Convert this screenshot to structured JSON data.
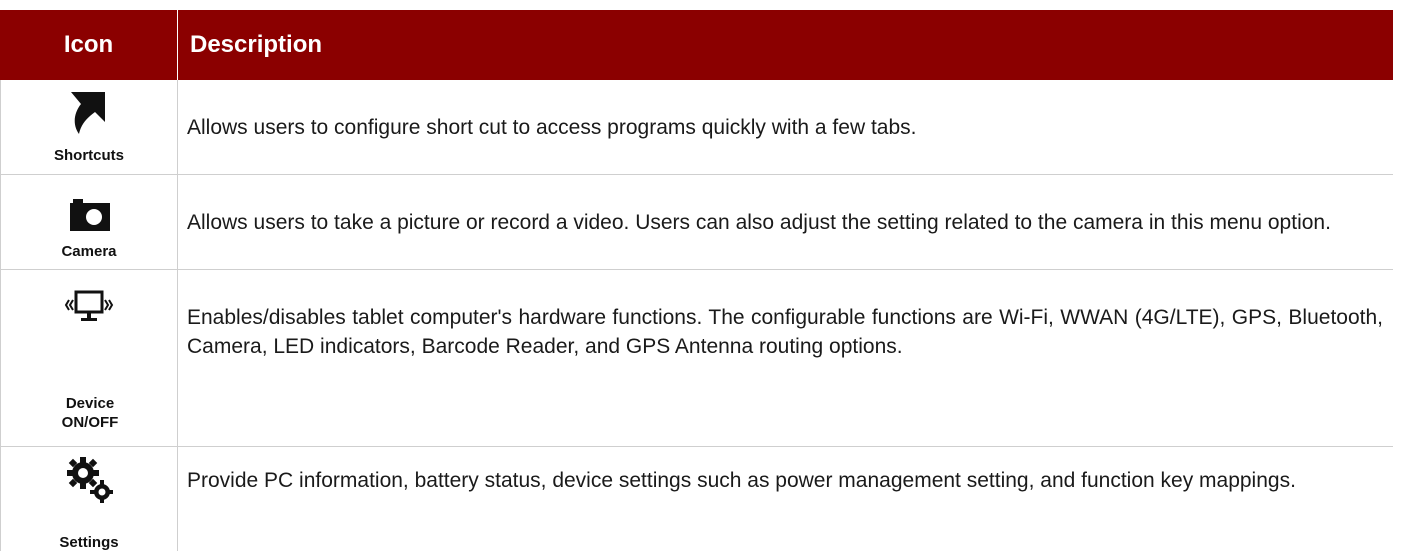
{
  "header": {
    "icon_col": "Icon",
    "desc_col": "Description"
  },
  "rows": [
    {
      "icon": "shortcut-arrow-icon",
      "label": "Shortcuts",
      "description": "Allows users to configure short cut to access programs quickly with a few tabs."
    },
    {
      "icon": "camera-icon",
      "label": "Camera",
      "description": "Allows users to take a picture or record a video. Users can also adjust the setting related to the camera in this menu option."
    },
    {
      "icon": "device-monitor-icon",
      "label": "Device ON/OFF",
      "description": "Enables/disables tablet computer's hardware functions. The configurable functions are Wi-Fi, WWAN (4G/LTE), GPS, Bluetooth, Camera, LED indicators, Barcode Reader, and GPS Antenna routing options."
    },
    {
      "icon": "settings-gears-icon",
      "label": "Settings",
      "description": "Provide PC information, battery status, device settings such as power management setting, and function key mappings."
    }
  ],
  "colors": {
    "header_bg": "#8b0000",
    "header_text": "#ffffff",
    "border": "#cfcfcf",
    "icon": "#111111"
  }
}
